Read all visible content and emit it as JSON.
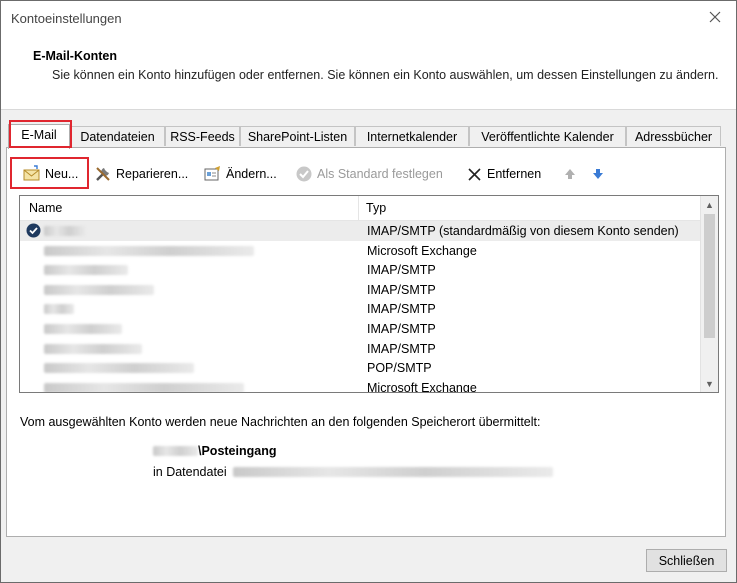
{
  "window": {
    "title": "Kontoeinstellungen"
  },
  "header": {
    "title": "E-Mail-Konten",
    "description": "Sie können ein Konto hinzufügen oder entfernen. Sie können ein Konto auswählen, um dessen Einstellungen zu ändern."
  },
  "tabs": [
    {
      "label": "E-Mail",
      "active": true
    },
    {
      "label": "Datendateien"
    },
    {
      "label": "RSS-Feeds"
    },
    {
      "label": "SharePoint-Listen"
    },
    {
      "label": "Internetkalender"
    },
    {
      "label": "Veröffentlichte Kalender"
    },
    {
      "label": "Adressbücher"
    }
  ],
  "toolbar": {
    "new_label": "Neu...",
    "repair_label": "Reparieren...",
    "change_label": "Ändern...",
    "set_default_label": "Als Standard festlegen",
    "remove_label": "Entfernen",
    "icons": {
      "new": "new-mail-icon",
      "repair": "tools-icon",
      "change": "edit-card-icon",
      "set_default": "check-circle-icon",
      "remove": "x-icon",
      "up": "arrow-up-icon",
      "down": "arrow-down-icon"
    }
  },
  "accounts_list": {
    "columns": [
      "Name",
      "Typ"
    ],
    "rows": [
      {
        "type": "IMAP/SMTP (standardmäßig von diesem Konto senden)",
        "selected": true,
        "default": true
      },
      {
        "type": "Microsoft Exchange"
      },
      {
        "type": "IMAP/SMTP"
      },
      {
        "type": "IMAP/SMTP"
      },
      {
        "type": "IMAP/SMTP"
      },
      {
        "type": "IMAP/SMTP"
      },
      {
        "type": "IMAP/SMTP"
      },
      {
        "type": "POP/SMTP"
      },
      {
        "type": "Microsoft Exchange"
      }
    ]
  },
  "delivery": {
    "info": "Vom ausgewählten Konto werden neue Nachrichten an den folgenden Speicherort übermittelt:",
    "folder_suffix": "\\Posteingang",
    "datafile_prefix": "in Datendatei"
  },
  "footer": {
    "close_label": "Schließen"
  }
}
